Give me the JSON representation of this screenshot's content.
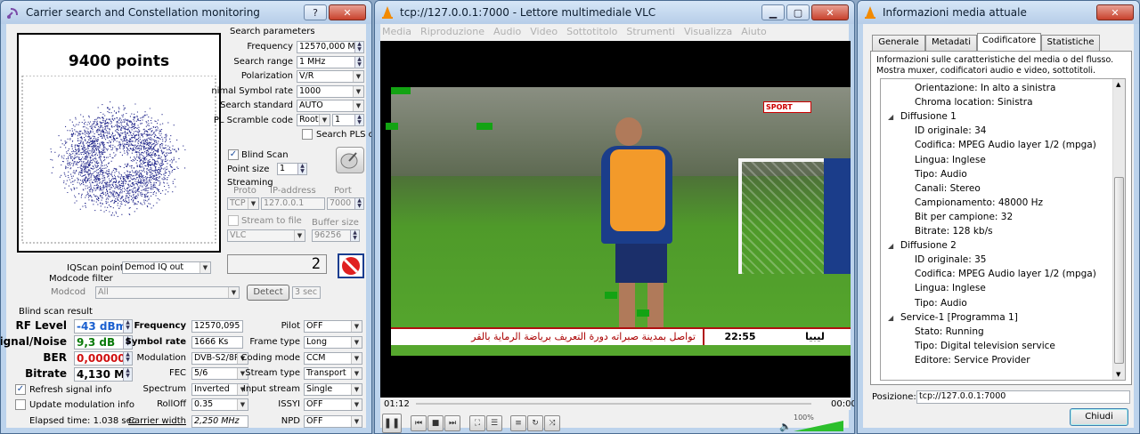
{
  "w1": {
    "title": "Carrier search and Constellation monitoring",
    "points": "9400 points",
    "search": {
      "group": "Search parameters",
      "frequency_label": "Frequency",
      "frequency": "12570,000 MH",
      "range_label": "Search range",
      "range": "1 MHz",
      "polarization_label": "Polarization",
      "polarization": "V/R",
      "symbol_label": "nimal Symbol rate",
      "symbol": "1000",
      "standard_label": "Search standard",
      "standard": "AUTO",
      "pls_label": "PL Scramble code",
      "pls_mode": "Root",
      "pls_value": "1",
      "search_pls": "Search PLS cc"
    },
    "blind_scan": "Blind Scan",
    "point_size_label": "Point size",
    "point_size": "1",
    "streaming": {
      "group": "Streaming",
      "proto_h": "Proto",
      "ip_h": "IP-address",
      "port_h": "Port",
      "proto": "TCP",
      "ip": "127.0.0.1",
      "port": "7000",
      "to_file": "Stream to file",
      "buffer_h": "Buffer size",
      "player": "VLC",
      "buffer": "96256"
    },
    "iq_label": "IQScan point",
    "iq": "Demod IQ out",
    "count": "2",
    "modcode_group": "Modcode filter",
    "modcode_label": "Modcod",
    "modcode": "All",
    "detect": "Detect",
    "detect_sec": "3 sec",
    "result": {
      "group": "Blind scan result",
      "rf_label": "RF Level",
      "rf": "-43 dBm",
      "sn_label": "ignal/Noise",
      "sn": "9,3 dB",
      "ber_label": "BER",
      "ber": "0,00000",
      "bitrate_label": "Bitrate",
      "bitrate": "4,130 Mb",
      "freq_label": "Frequency",
      "freq": "12570,095",
      "sr_label": "Symbol rate",
      "sr": "1666 Ks",
      "mod_label": "Modulation",
      "mod": "DVB-S2/8PS",
      "fec_label": "FEC",
      "fec": "5/6",
      "spectrum_label": "Spectrum",
      "spectrum": "Inverted",
      "rolloff_label": "RollOff",
      "rolloff": "0.35",
      "cw_label": "Carrier width",
      "cw": "2,250 MHz",
      "pilot_label": "Pilot",
      "pilot": "OFF",
      "frame_label": "Frame type",
      "frame": "Long",
      "coding_label": "Coding mode",
      "coding": "CCM",
      "stream_label": "Stream type",
      "stream": "Transport",
      "input_label": "Input stream",
      "input": "Single",
      "issyi_label": "ISSYI",
      "issyi": "OFF",
      "npd_label": "NPD",
      "npd": "OFF"
    },
    "refresh": "Refresh signal info",
    "update_mod": "Update modulation info",
    "elapsed": "Elapsed time: 1.038 sec"
  },
  "w2": {
    "title": "tcp://127.0.0.1:7000 - Lettore multimediale VLC",
    "menu": [
      "Media",
      "Riproduzione",
      "Audio",
      "Video",
      "Sottotitolo",
      "Strumenti",
      "Visualizza",
      "Aiuto"
    ],
    "time_elapsed": "01:12",
    "time_total": "00:00",
    "volume": "100%",
    "ticker": "تواصل بمدينة صبراته دورة التعريف برياضة الرماية بالقر",
    "clock": "22:55",
    "channel": "ليبيا",
    "logo": "SPORT"
  },
  "w3": {
    "title": "Informazioni media attuale",
    "tabs": [
      "Generale",
      "Metadati",
      "Codificatore",
      "Statistiche"
    ],
    "desc1": "Informazioni sulle caratteristiche del media o del flusso.",
    "desc2": "Mostra muxer, codificatori audio e video, sottotitoli.",
    "tree": [
      {
        "level": 2,
        "text": "Orientazione: In alto a sinistra"
      },
      {
        "level": 2,
        "text": "Chroma location: Sinistra"
      },
      {
        "level": 1,
        "text": "Diffusione 1"
      },
      {
        "level": 2,
        "text": "ID originale: 34"
      },
      {
        "level": 2,
        "text": "Codifica: MPEG Audio layer 1/2 (mpga)"
      },
      {
        "level": 2,
        "text": "Lingua: Inglese"
      },
      {
        "level": 2,
        "text": "Tipo: Audio"
      },
      {
        "level": 2,
        "text": "Canali: Stereo"
      },
      {
        "level": 2,
        "text": "Campionamento: 48000 Hz"
      },
      {
        "level": 2,
        "text": "Bit per campione: 32"
      },
      {
        "level": 2,
        "text": "Bitrate: 128 kb/s"
      },
      {
        "level": 1,
        "text": "Diffusione 2"
      },
      {
        "level": 2,
        "text": "ID originale: 35"
      },
      {
        "level": 2,
        "text": "Codifica: MPEG Audio layer 1/2 (mpga)"
      },
      {
        "level": 2,
        "text": "Lingua: Inglese"
      },
      {
        "level": 2,
        "text": "Tipo: Audio"
      },
      {
        "level": 1,
        "text": "Service-1 [Programma 1]"
      },
      {
        "level": 2,
        "text": "Stato: Running"
      },
      {
        "level": 2,
        "text": "Tipo: Digital television service"
      },
      {
        "level": 2,
        "text": "Editore: Service Provider"
      }
    ],
    "position_label": "Posizione:",
    "position": "tcp://127.0.0.1:7000",
    "close": "Chiudi"
  },
  "colors": {
    "rf": "#1a5fcf",
    "sn": "#0a7a0a",
    "ber": "#d01010",
    "dots": "#2a2f8f"
  }
}
